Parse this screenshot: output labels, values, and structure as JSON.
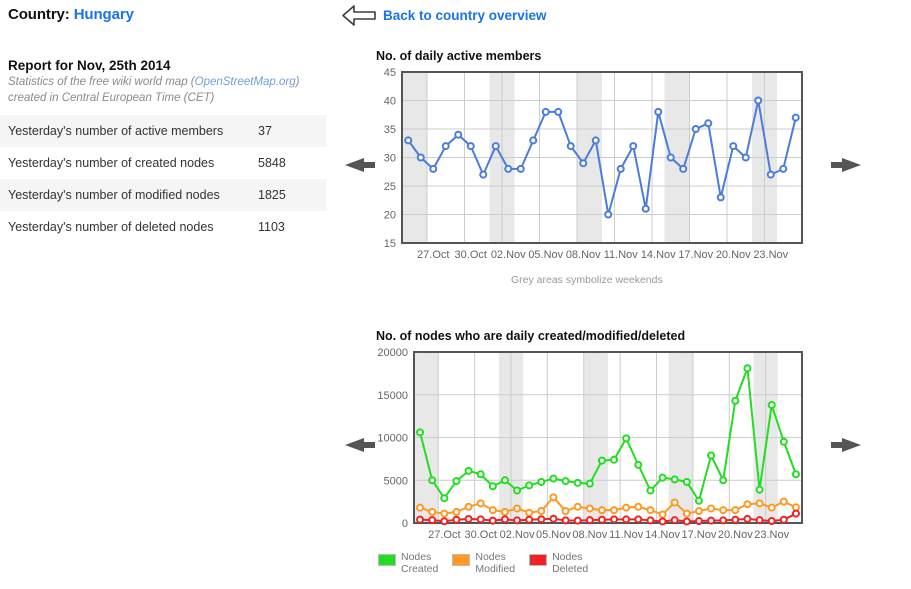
{
  "header": {
    "country_label": "Country:",
    "country_name": "Hungary"
  },
  "back_nav": {
    "label": "Back to country overview",
    "icon": "back-arrow-icon"
  },
  "report": {
    "title": "Report for Nov, 25th 2014",
    "subtitle_prefix": "Statistics of the free wiki world map (",
    "subtitle_link": "OpenStreetMap.org",
    "subtitle_suffix": ")",
    "subtitle_line2": "created in Central European Time (CET)"
  },
  "stats": {
    "rows": [
      {
        "label": "Yesterday's number of active members",
        "value": "37"
      },
      {
        "label": "Yesterday's number of created nodes",
        "value": "5848"
      },
      {
        "label": "Yesterday's number of modified nodes",
        "value": "1825"
      },
      {
        "label": "Yesterday's number of deleted nodes",
        "value": "1103"
      }
    ]
  },
  "nav": {
    "prev_icon": "left-arrow-icon",
    "next_icon": "right-arrow-icon"
  },
  "colors": {
    "link": "#1a73e8",
    "members_line": "#4a7ddb",
    "nodes_created": "#22dd22",
    "nodes_modified": "#ff9922",
    "nodes_deleted": "#ee2222",
    "weekend_band": "#e8e8e8",
    "grid": "#cccccc",
    "axis": "#555555",
    "row_alt": "#f5f5f5"
  },
  "chart_data": [
    {
      "id": "daily-active-members",
      "type": "line",
      "title": "No. of daily active members",
      "caption": "Grey areas symbolize weekends",
      "xlabel": "",
      "ylabel": "",
      "ylim": [
        15,
        45
      ],
      "yticks": [
        15,
        20,
        25,
        30,
        35,
        40,
        45
      ],
      "grid": true,
      "legend": null,
      "xtick_labels": [
        "27.Oct",
        "30.Oct",
        "02.Nov",
        "05.Nov",
        "08.Nov",
        "11.Nov",
        "14.Nov",
        "17.Nov",
        "20.Nov",
        "23.Nov"
      ],
      "xtick_indices": [
        2,
        5,
        8,
        11,
        14,
        17,
        20,
        23,
        26,
        29
      ],
      "weekend_indices": [
        0,
        1,
        7,
        8,
        14,
        15,
        21,
        22,
        28,
        29
      ],
      "n_points": 32,
      "series": [
        {
          "name": "Daily active members",
          "color": "#4a7ddb",
          "values": [
            33,
            30,
            28,
            32,
            34,
            32,
            27,
            32,
            28,
            28,
            33,
            38,
            38,
            32,
            29,
            33,
            20,
            28,
            32,
            21,
            38,
            30,
            28,
            35,
            36,
            23,
            32,
            30,
            40,
            27,
            28,
            37
          ]
        }
      ]
    },
    {
      "id": "daily-nodes-created-modified-deleted",
      "type": "line",
      "title": "No. of nodes who are daily created/modified/deleted",
      "caption": "",
      "xlabel": "",
      "ylabel": "",
      "ylim": [
        0,
        20000
      ],
      "yticks": [
        0,
        5000,
        10000,
        15000,
        20000
      ],
      "grid": true,
      "legend_position": "bottom-left",
      "xtick_labels": [
        "27.Oct",
        "30.Oct",
        "02.Nov",
        "05.Nov",
        "08.Nov",
        "11.Nov",
        "14.Nov",
        "17.Nov",
        "20.Nov",
        "23.Nov"
      ],
      "xtick_indices": [
        2,
        5,
        8,
        11,
        14,
        17,
        20,
        23,
        26,
        29
      ],
      "weekend_indices": [
        0,
        1,
        7,
        8,
        14,
        15,
        21,
        22,
        28,
        29
      ],
      "n_points": 32,
      "series": [
        {
          "name": "Nodes\nCreated",
          "legend_label": "Nodes\nCreated",
          "color": "#22dd22",
          "values": [
            10600,
            5000,
            2900,
            4900,
            6100,
            5700,
            4300,
            5000,
            3800,
            4400,
            4800,
            5200,
            4900,
            4700,
            4600,
            7300,
            7400,
            9900,
            6800,
            3800,
            5300,
            5100,
            4800,
            2600,
            7900,
            5000,
            14300,
            18100,
            3900,
            13800,
            9500,
            5700
          ]
        },
        {
          "name": "Nodes\nModified",
          "legend_label": "Nodes\nModified",
          "color": "#ff9922",
          "values": [
            1800,
            1300,
            1100,
            1300,
            1900,
            2300,
            1500,
            1300,
            1700,
            1200,
            1400,
            3000,
            1400,
            1900,
            1700,
            1500,
            1500,
            1800,
            1900,
            1500,
            1000,
            2400,
            1100,
            1400,
            1700,
            1500,
            1500,
            2200,
            2300,
            1800,
            2500,
            1825
          ]
        },
        {
          "name": "Nodes\nDeleted",
          "legend_label": "Nodes\nDeleted",
          "color": "#ee2222",
          "values": [
            400,
            330,
            200,
            380,
            470,
            420,
            280,
            420,
            300,
            380,
            440,
            500,
            300,
            280,
            330,
            380,
            430,
            420,
            430,
            300,
            180,
            330,
            180,
            230,
            280,
            300,
            380,
            480,
            330,
            230,
            380,
            1103
          ]
        }
      ]
    }
  ]
}
